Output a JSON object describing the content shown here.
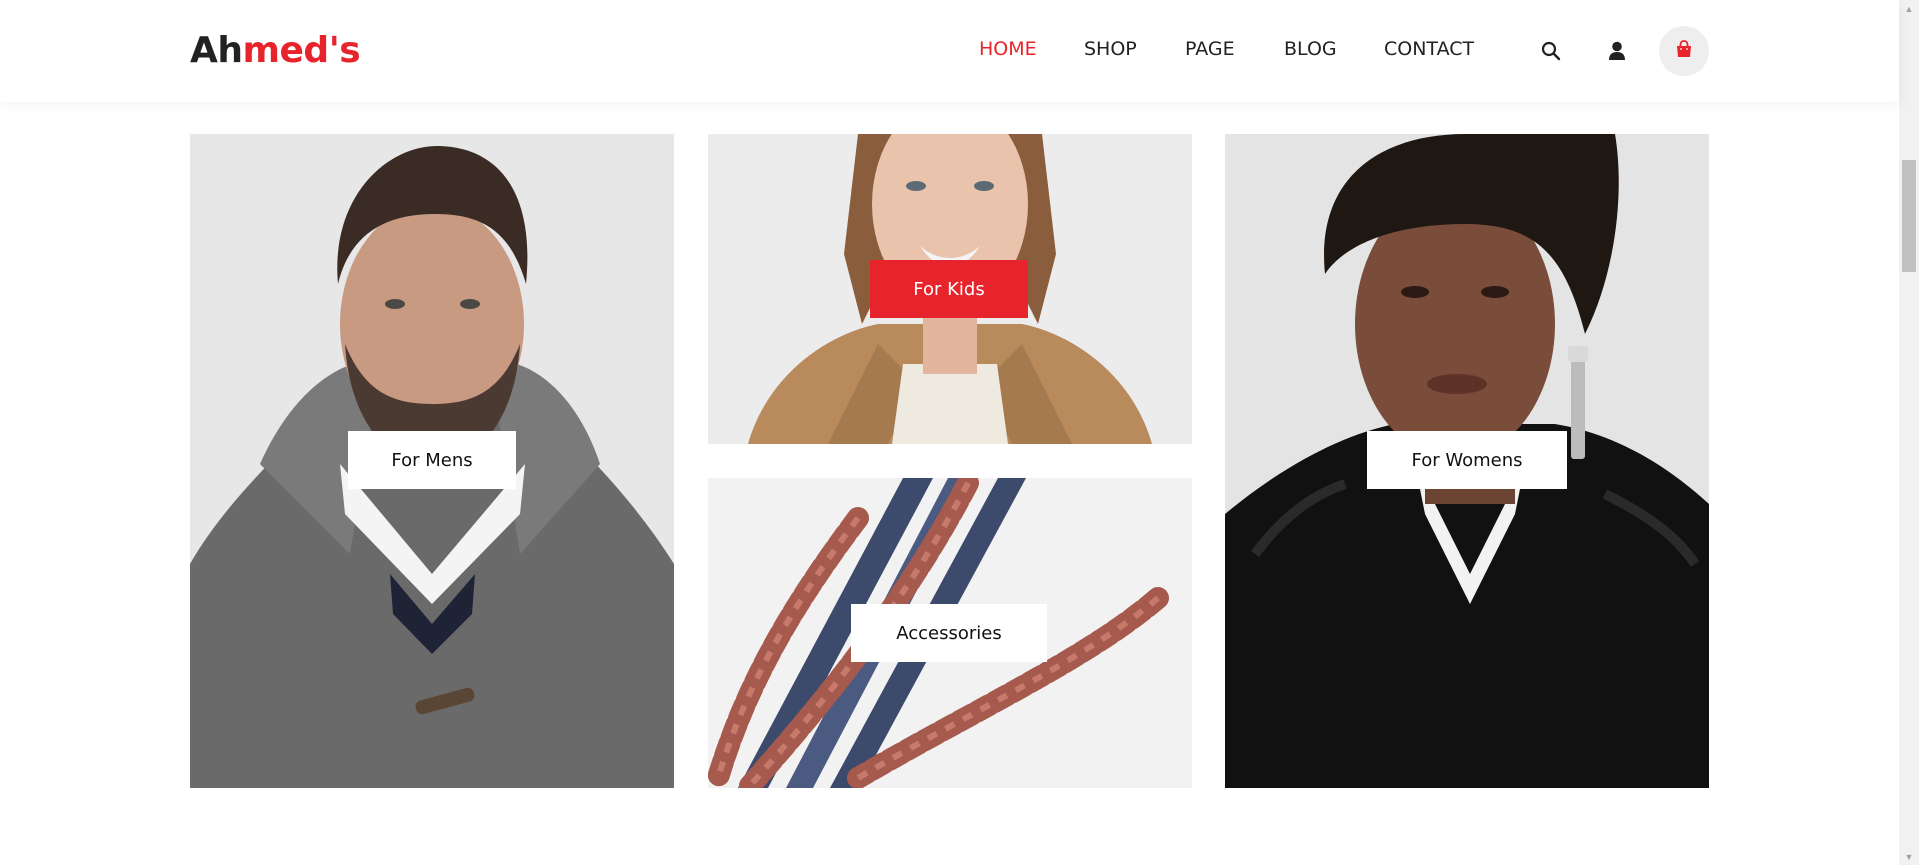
{
  "brand": {
    "logo_part1": "Ah",
    "logo_part2": "med's"
  },
  "nav": {
    "items": [
      {
        "label": "HOME",
        "active": true
      },
      {
        "label": "SHOP",
        "active": false
      },
      {
        "label": "PAGE",
        "active": false
      },
      {
        "label": "BLOG",
        "active": false
      },
      {
        "label": "CONTACT",
        "active": false
      }
    ]
  },
  "header_icons": [
    "search-icon",
    "user-icon",
    "shopping-bag-icon"
  ],
  "categories": {
    "mens": {
      "label": "For Mens"
    },
    "kids": {
      "label": "For Kids"
    },
    "accessories": {
      "label": "Accessories"
    },
    "womens": {
      "label": "For Womens"
    }
  },
  "colors": {
    "accent": "#e7242b",
    "text": "#222222",
    "cart_bg": "#eeeeee"
  }
}
